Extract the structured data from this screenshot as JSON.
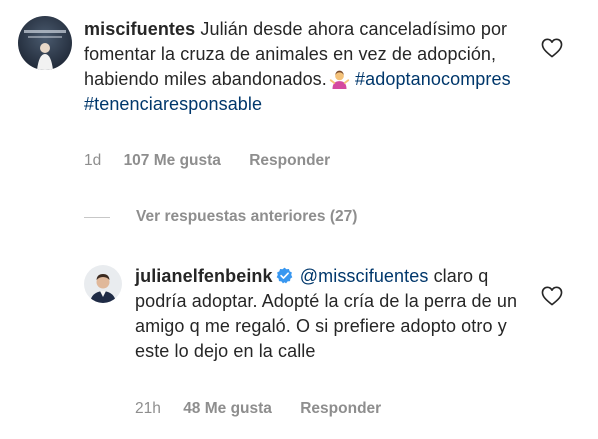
{
  "comment1": {
    "username": "miscifuentes",
    "text_before": "Julián desde ahora canceladísimo por fomentar la cruza de animales en vez de adopción, habiendo miles abandonados.",
    "emoji": "woman-shrugging-emoji",
    "hashtag1": "#adoptanocompres",
    "hashtag2": "#tenenciaresponsable",
    "time": "1d",
    "likes": "107 Me gusta",
    "reply": "Responder"
  },
  "view_replies": {
    "label": "Ver respuestas anteriores (27)"
  },
  "comment2": {
    "username": "julianelfenbeink",
    "mention": "@misscifuentes",
    "text": "claro q podría adoptar. Adopté la cría de la perra de un amigo q me regaló. O si prefiere adopto otro y este lo dejo en la calle",
    "time": "21h",
    "likes": "48 Me gusta",
    "reply": "Responder"
  },
  "icons": {
    "heart": "heart-outline-icon",
    "verified": "verified-badge-icon"
  },
  "colors": {
    "link": "#00376b",
    "muted": "#8e8e8e",
    "verified": "#3897f0"
  }
}
